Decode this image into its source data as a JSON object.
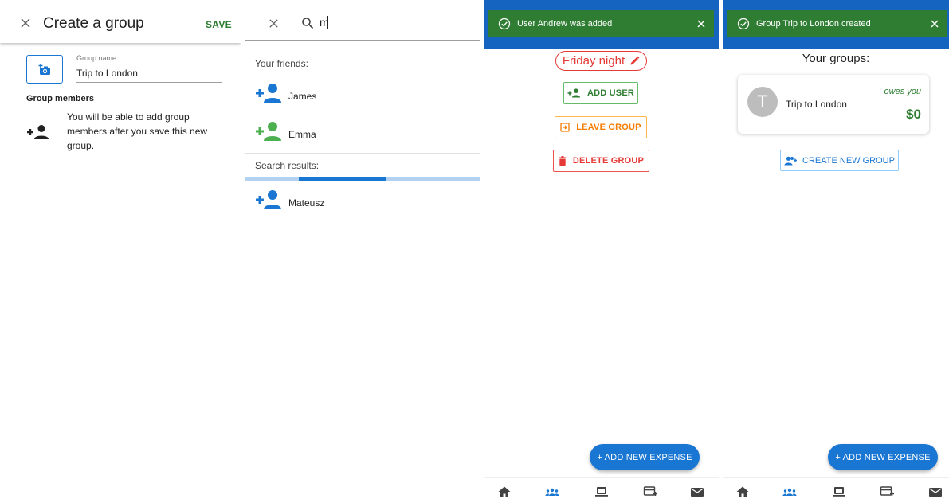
{
  "colors": {
    "primary": "#1976d2",
    "success": "#2e7d32",
    "warning": "#f57c00",
    "danger": "#e53935",
    "toast_bar": "#1565c0"
  },
  "create_group": {
    "title": "Create a group",
    "save_label": "SAVE",
    "group_name_label": "Group name",
    "group_name_value": "Trip to London",
    "members_title": "Group members",
    "members_hint": "You will be able to add group members after you save this new group."
  },
  "search_friends": {
    "query": "m",
    "friends_label": "Your friends:",
    "friends": [
      {
        "name": "James",
        "icon": "person-add-icon",
        "color": "#1976d2"
      },
      {
        "name": "Emma",
        "icon": "person-add-icon",
        "color": "#4caf50"
      }
    ],
    "results_label": "Search results:",
    "loading_progress": 0.6,
    "results": [
      {
        "name": "Mateusz",
        "icon": "person-add-icon",
        "color": "#1976d2"
      }
    ]
  },
  "group_detail": {
    "toast": "User Andrew was added",
    "group_name": "Friday night",
    "add_user_label": "ADD USER",
    "leave_group_label": "LEAVE GROUP",
    "delete_group_label": "DELETE GROUP",
    "fab_label": "+ ADD NEW EXPENSE"
  },
  "groups_list": {
    "toast": "Group Trip to London created",
    "title": "Your groups:",
    "groups": [
      {
        "initial": "T",
        "name": "Trip to London",
        "status": "owes you",
        "amount": "$0"
      }
    ],
    "create_label": "CREATE NEW GROUP",
    "fab_label": "+ ADD NEW EXPENSE"
  },
  "bottom_nav": [
    "home-icon",
    "groups-icon",
    "payments-icon",
    "add-card-icon",
    "mail-icon"
  ]
}
